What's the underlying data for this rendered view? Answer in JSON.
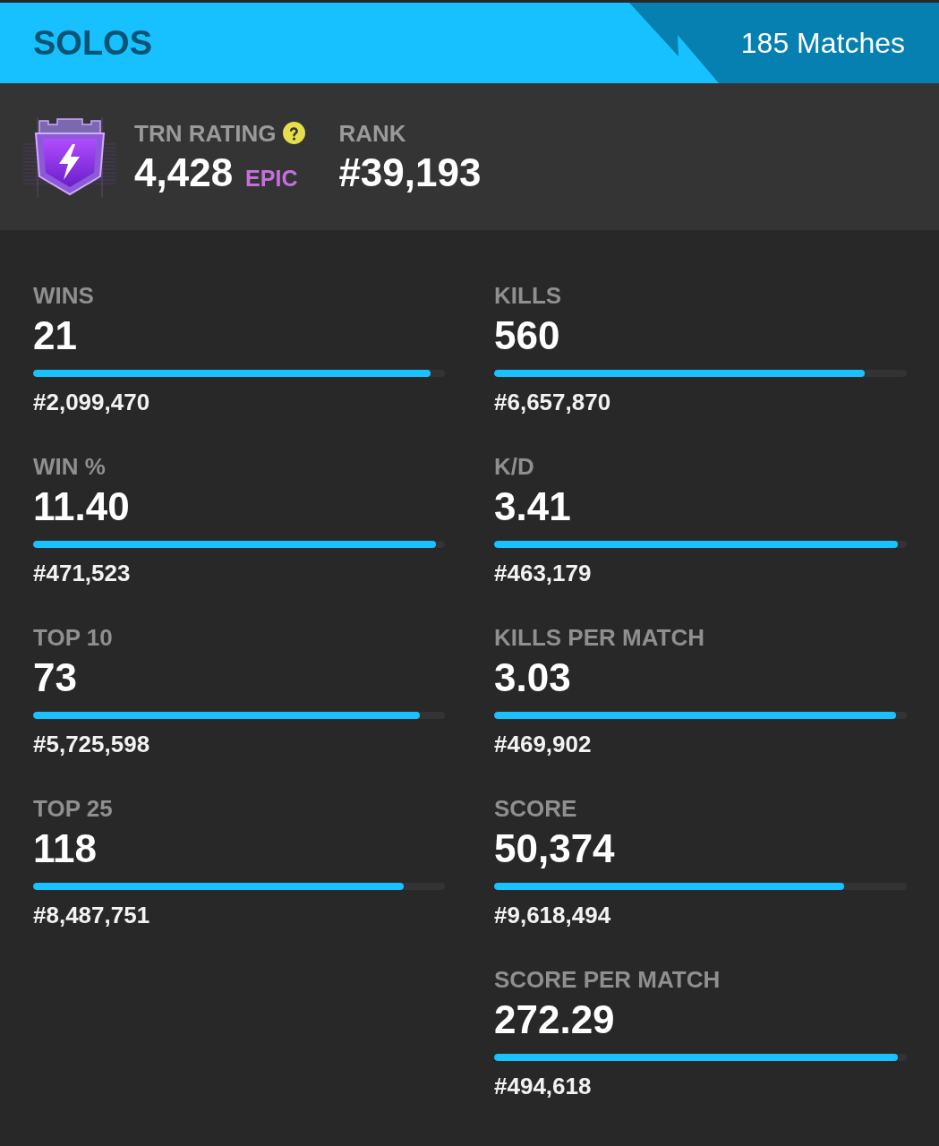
{
  "mode": {
    "title": "SOLOS",
    "matches": "185 Matches"
  },
  "rating": {
    "label": "TRN RATING",
    "value": "4,428",
    "tier": "EPIC"
  },
  "rank": {
    "label": "RANK",
    "value": "#39,193"
  },
  "stat_columns": [
    {
      "stats": [
        {
          "label": "WINS",
          "value": "21",
          "level": 0.965,
          "rank": "#2,099,470"
        },
        {
          "label": "WIN %",
          "value": "11.40",
          "level": 0.978,
          "rank": "#471,523"
        },
        {
          "label": "TOP 10",
          "value": "73",
          "level": 0.939,
          "rank": "#5,725,598"
        },
        {
          "label": "TOP 25",
          "value": "118",
          "level": 0.9,
          "rank": "#8,487,751"
        }
      ]
    },
    {
      "stats": [
        {
          "label": "KILLS",
          "value": "560",
          "level": 0.898,
          "rank": "#6,657,870"
        },
        {
          "label": "K/D",
          "value": "3.41",
          "level": 0.978,
          "rank": "#463,179"
        },
        {
          "label": "KILLS PER MATCH",
          "value": "3.03",
          "level": 0.974,
          "rank": "#469,902"
        },
        {
          "label": "SCORE",
          "value": "50,374",
          "level": 0.848,
          "rank": "#9,618,494"
        },
        {
          "label": "SCORE PER MATCH",
          "value": "272.29",
          "level": 0.978,
          "rank": "#494,618"
        }
      ]
    }
  ]
}
